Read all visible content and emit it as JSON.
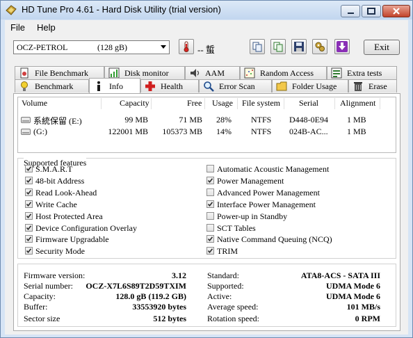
{
  "window": {
    "title": "HD Tune Pro 4.61 - Hard Disk Utility (trial version)"
  },
  "menu": {
    "file": "File",
    "help": "Help"
  },
  "toolbar": {
    "drive_name": "OCZ-PETROL",
    "drive_size": "(128 gB)",
    "temperature": "-- 蜇",
    "exit_label": "Exit",
    "icons": [
      "copy-icon",
      "copy-all-icon",
      "save-icon",
      "options-icon",
      "download-icon"
    ]
  },
  "tabs_top": [
    "File Benchmark",
    "Disk monitor",
    "AAM",
    "Random Access",
    "Extra tests"
  ],
  "tabs_bottom": [
    "Benchmark",
    "Info",
    "Health",
    "Error Scan",
    "Folder Usage",
    "Erase"
  ],
  "active_tab": "Info",
  "volumes": {
    "headers": [
      "Volume",
      "Capacity",
      "Free",
      "Usage",
      "File system",
      "Serial",
      "Alignment"
    ],
    "rows": [
      [
        "系統保留 (E:)",
        "99 MB",
        "71 MB",
        "28%",
        "NTFS",
        "D448-0E94",
        "1 MB"
      ],
      [
        "(G:)",
        "122001 MB",
        "105373 MB",
        "14%",
        "NTFS",
        "024B-AC...",
        "1 MB"
      ]
    ]
  },
  "features": {
    "title": "Supported features",
    "left": [
      {
        "label": "S.M.A.R.T",
        "checked": true
      },
      {
        "label": "48-bit Address",
        "checked": true
      },
      {
        "label": "Read Look-Ahead",
        "checked": true
      },
      {
        "label": "Write Cache",
        "checked": true
      },
      {
        "label": "Host Protected Area",
        "checked": true
      },
      {
        "label": "Device Configuration Overlay",
        "checked": true
      },
      {
        "label": "Firmware Upgradable",
        "checked": true
      },
      {
        "label": "Security Mode",
        "checked": true
      }
    ],
    "right": [
      {
        "label": "Automatic Acoustic Management",
        "checked": false
      },
      {
        "label": "Power Management",
        "checked": true
      },
      {
        "label": "Advanced Power Management",
        "checked": false
      },
      {
        "label": "Interface Power Management",
        "checked": true
      },
      {
        "label": "Power-up in Standby",
        "checked": false
      },
      {
        "label": "SCT Tables",
        "checked": false
      },
      {
        "label": "Native Command Queuing (NCQ)",
        "checked": true
      },
      {
        "label": "TRIM",
        "checked": true
      }
    ]
  },
  "info": {
    "firmware_label": "Firmware version:",
    "firmware": "3.12",
    "serial_label": "Serial number:",
    "serial": "OCZ-X7L6S89T2D59TXIM",
    "capacity_label": "Capacity:",
    "capacity": "128.0 gB (119.2 GB)",
    "buffer_label": "Buffer:",
    "buffer": "33553920 bytes",
    "sector_label": "Sector size",
    "sector": "512 bytes",
    "standard_label": "Standard:",
    "standard": "ATA8-ACS - SATA III",
    "supported_label": "Supported:",
    "supported": "UDMA Mode 6",
    "active_label": "Active:",
    "active": "UDMA Mode 6",
    "avg_speed_label": "Average speed:",
    "avg_speed": "101 MB/s",
    "rotation_label": "Rotation speed:",
    "rotation": "0 RPM"
  }
}
